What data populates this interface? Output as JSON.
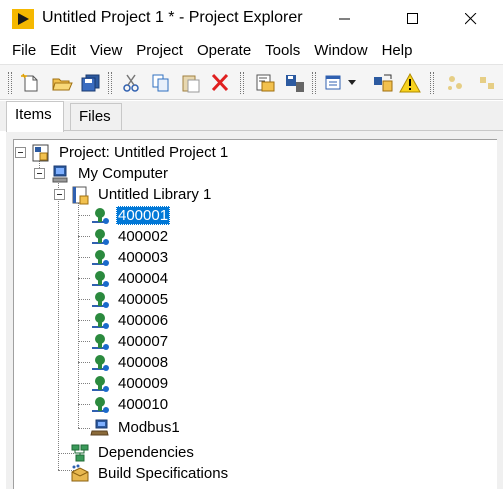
{
  "window": {
    "title": "Untitled Project 1 * - Project Explorer",
    "icon": "labview-run-arrow-icon",
    "controls": [
      "minimize",
      "maximize",
      "close"
    ]
  },
  "menu": [
    "File",
    "Edit",
    "View",
    "Project",
    "Operate",
    "Tools",
    "Window",
    "Help"
  ],
  "toolbar": {
    "buttons": [
      "new-icon",
      "open-icon",
      "save-all-icon",
      "cut-icon",
      "copy-icon",
      "paste-icon",
      "delete-icon",
      "build-icon",
      "deploy-icon",
      "view-icon",
      "resolve-conflicts-icon",
      "warning-icon",
      "collapse-icon"
    ]
  },
  "tabs": {
    "items": "Items",
    "files": "Files",
    "active": "Items"
  },
  "tree": {
    "project": "Project: Untitled Project 1",
    "computer": "My Computer",
    "library": "Untitled Library 1",
    "variables": [
      "400001",
      "400002",
      "400003",
      "400004",
      "400005",
      "400006",
      "400007",
      "400008",
      "400009",
      "400010"
    ],
    "selected": "400001",
    "server": "Modbus1",
    "dependencies": "Dependencies",
    "build": "Build Specifications"
  },
  "colors": {
    "selection": "#0078d7",
    "app_icon": "#f5b800"
  }
}
